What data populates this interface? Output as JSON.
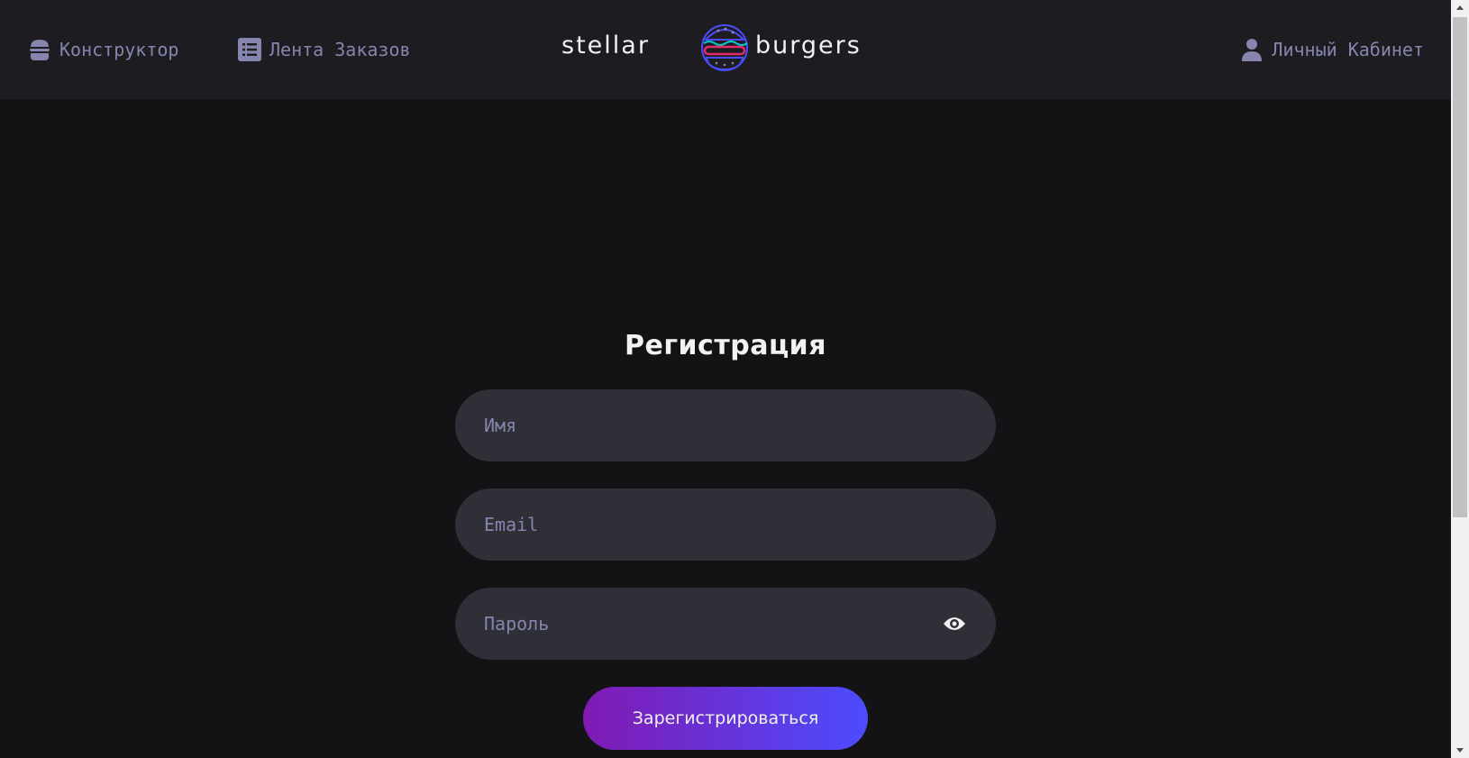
{
  "header": {
    "nav_constructor": {
      "label": "Конструктор",
      "icon": "burger-icon"
    },
    "nav_feed": {
      "label": "Лента Заказов",
      "icon": "list-icon"
    },
    "nav_profile": {
      "label": "Личный Кабинет",
      "icon": "profile-icon"
    },
    "logo_text_left": "stellar",
    "logo_text_right": "burgers"
  },
  "form": {
    "title": "Регистрация",
    "name_placeholder": "Имя",
    "email_placeholder": "Email",
    "password_placeholder": "Пароль",
    "password_toggle_icon": "eye-icon",
    "submit_label": "Зарегистрироваться"
  },
  "colors": {
    "page_bg": "#131316",
    "header_bg": "#1c1c21",
    "input_bg": "#2f2f37",
    "muted_text": "#8585ad",
    "primary_text": "#f2f2f3",
    "button_gradient_start": "#801ab2",
    "button_gradient_end": "#4c4cff"
  }
}
